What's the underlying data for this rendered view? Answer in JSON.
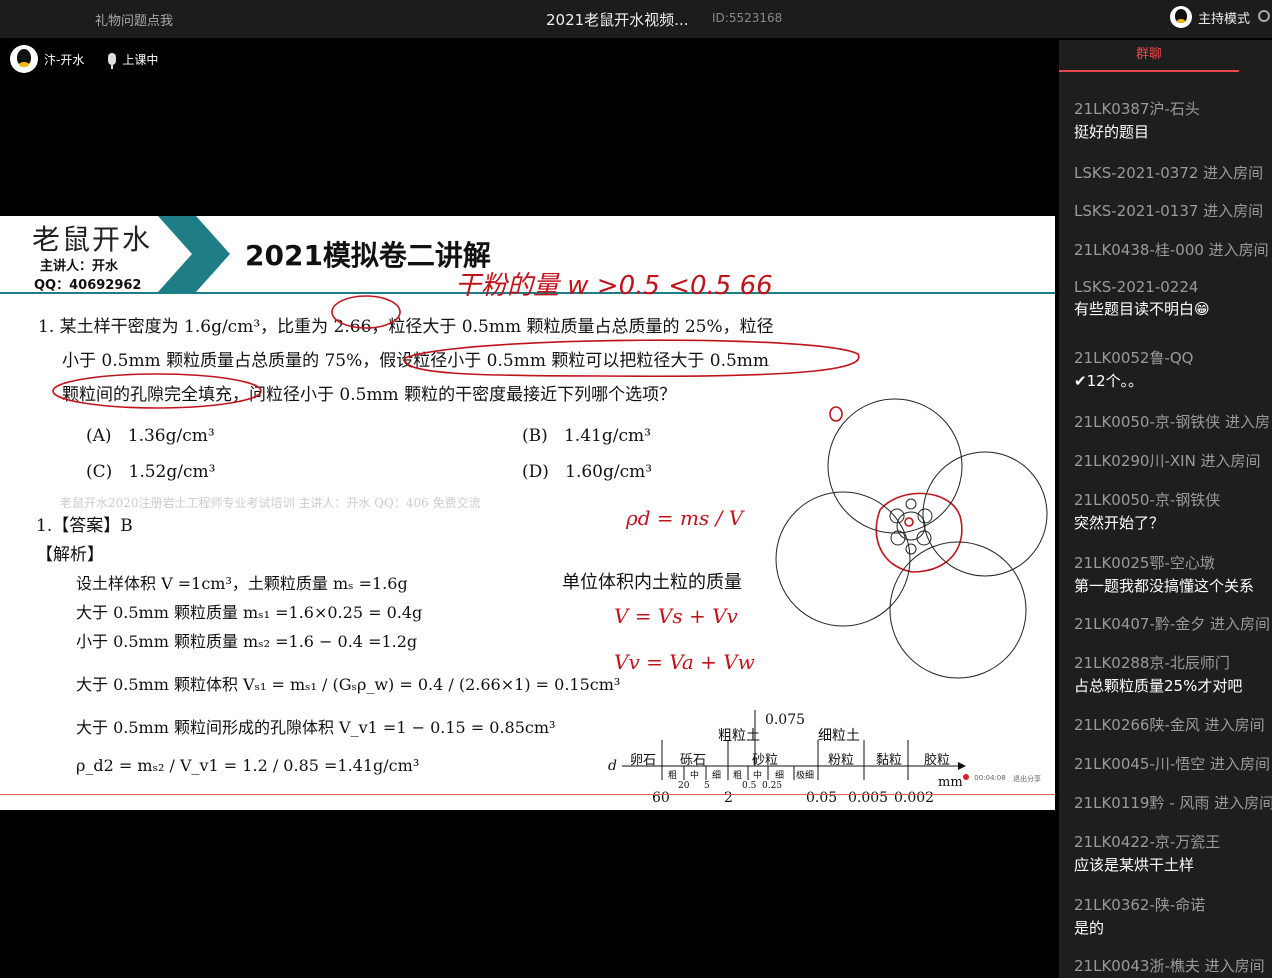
{
  "topbar": {
    "left_link": "礼物问题点我",
    "title": "2021老鼠开水视频...",
    "room_id": "ID:5523168",
    "host_mode": "主持模式"
  },
  "broadcaster": {
    "name": "汴-开水",
    "status": "上课中"
  },
  "slide": {
    "logo": "老鼠开水",
    "presenter": "主讲人：开水",
    "qq": "QQ：40692962",
    "title": "2021模拟卷二讲解",
    "question_line1": "1. 某土样干密度为 1.6g/cm³，比重为 2.66，粒径大于 0.5mm 颗粒质量占总质量的 25%，粒径",
    "question_line2": "小于 0.5mm 颗粒质量占总质量的 75%，假设粒径小于 0.5mm 颗粒可以把粒径大于 0.5mm",
    "question_line3": "颗粒间的孔隙完全填充，问粒径小于 0.5mm 颗粒的干密度最接近下列哪个选项？",
    "options": [
      {
        "key": "(A)",
        "value": "1.36g/cm³"
      },
      {
        "key": "(B)",
        "value": "1.41g/cm³"
      },
      {
        "key": "(C)",
        "value": "1.52g/cm³"
      },
      {
        "key": "(D)",
        "value": "1.60g/cm³"
      }
    ],
    "watermark": "老鼠开水2020注册岩土工程师专业考试培训        主讲人：开水   QQ：406        免费交流",
    "answer": "1.【答案】B",
    "analysis": "【解析】",
    "solution_lines": [
      "设土样体积 V =1cm³，土颗粒质量 mₛ =1.6g",
      "大于 0.5mm 颗粒质量 mₛ₁ =1.6×0.25 = 0.4g",
      "小于 0.5mm 颗粒质量 mₛ₂ =1.6 − 0.4 =1.2g",
      "大于 0.5mm 颗粒体积 Vₛ₁ = mₛ₁ / (Gₛρ_w) = 0.4 / (2.66×1) = 0.15cm³",
      "大于 0.5mm 颗粒间形成的孔隙体积 V_v1 =1 − 0.15 = 0.85cm³",
      "ρ_d2 = mₛ₂ / V_v1 = 1.2 / 0.85 =1.41g/cm³"
    ],
    "formula_rho": "ρd = ms / V",
    "formula_v": "V = Vs + Vv",
    "formula_vv": "Vv = Va + Vw",
    "unit_mass_text": "单位体积内土粒的质量",
    "handwriting": "干粉的量   w   >0.5 <0.5 66",
    "scale": {
      "top_label": "0.075",
      "coarse": "粗粒土",
      "fine": "细粒土",
      "categories": [
        "卵石",
        "砾石",
        "砂粒",
        "粉粒",
        "黏粒",
        "胶粒"
      ],
      "sub": [
        "粗",
        "中",
        "细",
        "粗",
        "中",
        "细",
        "极细"
      ],
      "numbers_small": [
        "20",
        "5",
        "0.5",
        "0.25"
      ],
      "numbers": [
        "60",
        "2",
        "0.05",
        "0.005",
        "0.002"
      ],
      "d": "d",
      "unit": "mm"
    },
    "recording_time": "00:04:08",
    "exit_share": "退出分享"
  },
  "chat": {
    "tab": "群聊",
    "messages": [
      {
        "name": "21LK0387沪-石头",
        "text": "挺好的题目"
      },
      {
        "name": "LSKS-2021-0372 进入房间",
        "text": ""
      },
      {
        "name": "LSKS-2021-0137 进入房间",
        "text": ""
      },
      {
        "name": "21LK0438-桂-000 进入房间",
        "text": ""
      },
      {
        "name": "LSKS-2021-0224",
        "text": "有些题目读不明白😁"
      },
      {
        "name": "21LK0052鲁-QQ",
        "text": "✔12个。。"
      },
      {
        "name": "21LK0050-京-钢铁侠 进入房",
        "text": ""
      },
      {
        "name": "21LK0290川-XIN 进入房间",
        "text": ""
      },
      {
        "name": "21LK0050-京-钢铁侠",
        "text": "突然开始了？"
      },
      {
        "name": "21LK0025鄂-空心墩",
        "text": "第一题我都没搞懂这个关系"
      },
      {
        "name": "21LK0407-黔-金夕 进入房间",
        "text": ""
      },
      {
        "name": "21LK0288京-北辰师门",
        "text": "占总颗粒质量25%才对吧"
      },
      {
        "name": "21LK0266陕-金风 进入房间",
        "text": ""
      },
      {
        "name": "21LK0045-川-悟空 进入房间",
        "text": ""
      },
      {
        "name": "21LK0119黔 - 风雨 进入房间",
        "text": ""
      },
      {
        "name": "21LK0422-京-万瓷王",
        "text": "应该是某烘干土样"
      },
      {
        "name": "21LK0362-陕-命诺",
        "text": "是的"
      },
      {
        "name": "21LK0043浙-樵夫 进入房间",
        "text": ""
      }
    ]
  },
  "colors": {
    "accent": "#e8484a",
    "teal": "#1f7d86",
    "ink_red": "#c0141c"
  }
}
